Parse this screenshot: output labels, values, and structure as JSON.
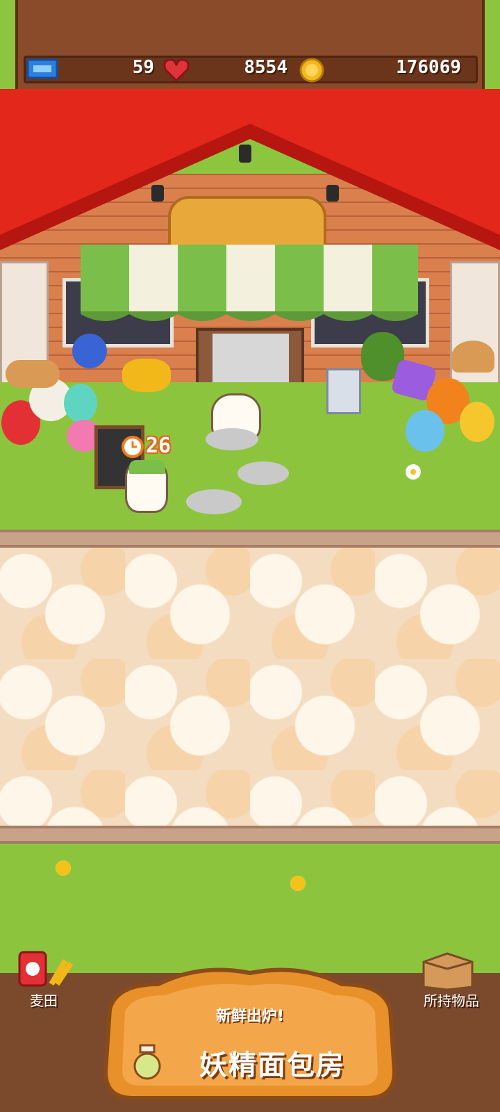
{
  "status": {
    "tickets": "59",
    "hearts": "8554",
    "coins": "176069"
  },
  "timer": {
    "value": "26"
  },
  "nav": {
    "left_label": "麦田",
    "right_label": "所持物品"
  },
  "banner": {
    "subtitle": "新鲜出炉!",
    "title": "妖精面包房"
  },
  "colors": {
    "roof": "#e3271b",
    "board": "#8a4b2a",
    "grass": "#8dc43e",
    "awning_green": "#7bbf4a",
    "awning_white": "#f4f0de"
  },
  "icons": [
    "ticket-icon",
    "heart-icon",
    "coin-icon",
    "clock-icon",
    "wheat-bag-icon",
    "box-icon"
  ]
}
